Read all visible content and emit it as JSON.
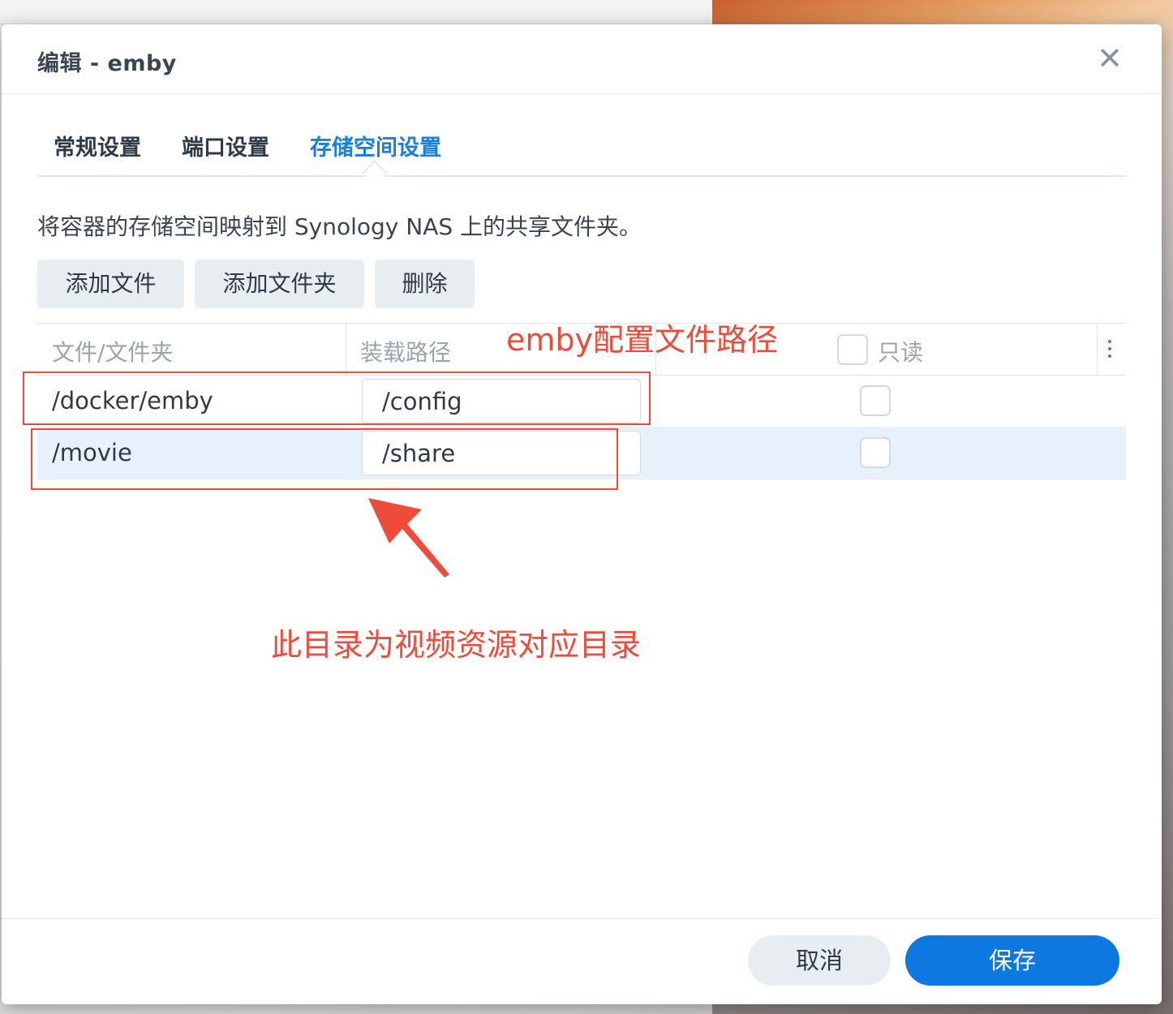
{
  "dialog": {
    "title": "编辑 - emby"
  },
  "tabs": [
    {
      "label": "常规设置"
    },
    {
      "label": "端口设置"
    },
    {
      "label": "存储空间设置"
    }
  ],
  "storage": {
    "description": "将容器的存储空间映射到 Synology NAS 上的共享文件夹。",
    "buttons": {
      "add_file": "添加文件",
      "add_folder": "添加文件夹",
      "delete": "删除"
    },
    "columns": {
      "file_folder": "文件/文件夹",
      "mount_path": "装载路径",
      "read_only": "只读"
    },
    "rows": [
      {
        "path": "/docker/emby",
        "mount": "/config",
        "read_only": false
      },
      {
        "path": "/movie",
        "mount": "/share",
        "read_only": false
      }
    ]
  },
  "annotations": {
    "config_label": "emby配置文件路径",
    "video_label": "此目录为视频资源对应目录",
    "color": "#ef4b3a"
  },
  "footer": {
    "cancel": "取消",
    "save": "保存"
  },
  "colors": {
    "accent": "#0d79e0",
    "active_tab": "#1a7fd8",
    "selected_row": "#e6f1fc"
  }
}
